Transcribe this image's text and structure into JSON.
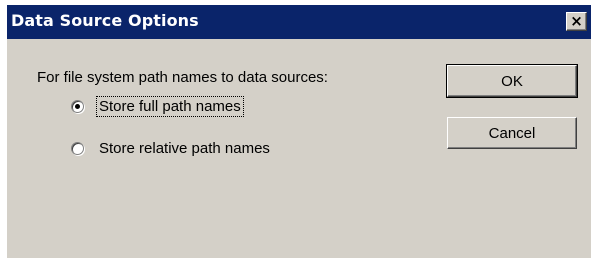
{
  "dialog": {
    "title": "Data Source Options",
    "close_label": "×"
  },
  "content": {
    "prompt": "For file system path names to data sources:",
    "options": [
      {
        "label": "Store full path names",
        "checked": true
      },
      {
        "label": "Store relative path names",
        "checked": false
      }
    ]
  },
  "buttons": {
    "ok_label": "OK",
    "cancel_label": "Cancel"
  },
  "colors": {
    "titlebar": "#0a246a",
    "dialog_face": "#d4d0c8"
  }
}
